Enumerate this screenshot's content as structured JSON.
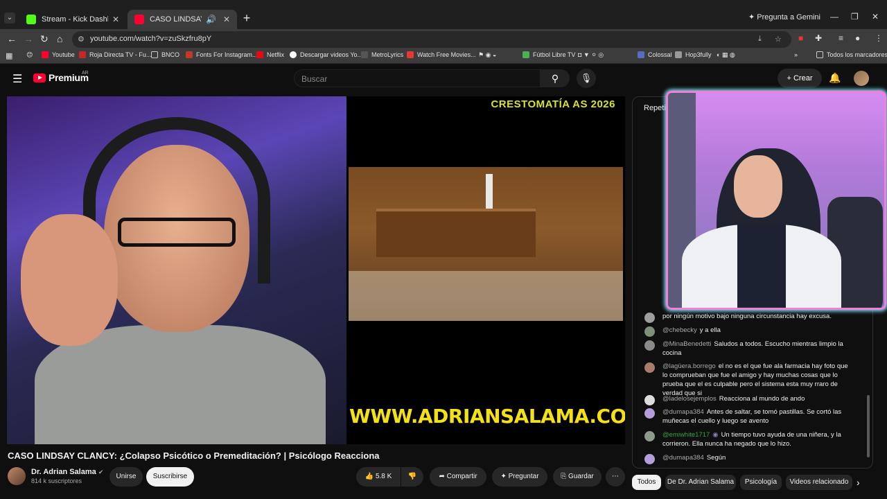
{
  "browser": {
    "tabs": [
      {
        "title": "Stream - Kick Dashboard",
        "favicon_color": "#53fc18"
      },
      {
        "title": "CASO LINDSAY CLANCY: ¿C",
        "favicon_color": "#ff0033"
      }
    ],
    "gemini_label": "Pregunta a Gemini",
    "url": "youtube.com/watch?v=zuSkzfru8pY",
    "bookmarks": [
      {
        "label": "Youtube",
        "color": "#ff0033"
      },
      {
        "label": "Roja Directa TV - Fu...",
        "color": "#c62828"
      },
      {
        "label": "BNCO",
        "color": "#888888"
      },
      {
        "label": "Fonts For Instagram...",
        "color": "#c0392b"
      },
      {
        "label": "Netflix",
        "color": "#e50914"
      },
      {
        "label": "Descargar videos Yo...",
        "color": "#ffffff"
      },
      {
        "label": "MetroLyrics",
        "color": "#333333"
      },
      {
        "label": "Watch Free Movies...",
        "color": "#e53935"
      },
      {
        "label": "Fútbol Libre TV",
        "color": "#4caf50"
      },
      {
        "label": "Colossal",
        "color": "#5c6bc0"
      },
      {
        "label": "Hop3fully",
        "color": "#999999"
      }
    ],
    "all_bookmarks": "Todos los marcadores"
  },
  "youtube": {
    "logo_word": "Premium",
    "region": "AR",
    "search_placeholder": "Buscar",
    "create_label": "Crear"
  },
  "video": {
    "slide_headline": "CRESTOMATÍA AS 2026",
    "slide_site": "WWW.ADRIANSALAMA.COM",
    "title": "CASO LINDSAY CLANCY: ¿Colapso Psicótico o Premeditación? | Psicólogo Reacciona",
    "channel": "Dr. Adrian Salama",
    "subscribers": "814 k suscriptores",
    "join_label": "Unirse",
    "subscribe_label": "Suscribirse",
    "likes": "5.8 K",
    "share_label": "Compartir",
    "ask_label": "Preguntar",
    "save_label": "Guardar"
  },
  "chat": {
    "header": "Repeti",
    "messages": [
      {
        "author": "",
        "text": "por ningún motivo bajo ninguna circunstancia hay excusa.",
        "author_color": "#aaaaaa",
        "avatar_color": "#9e9e9e"
      },
      {
        "author": "@chebecky",
        "text": "y a ella",
        "avatar_color": "#7e8f7a"
      },
      {
        "author": "@MinaBenedetti",
        "text": "Saludos a todos. Escucho mientras limpio la cocina",
        "avatar_color": "#8a8a8a"
      },
      {
        "author": "@lagüera.borrego",
        "text": "el no es el que fue ala farmacia hay foto que lo comprueban que fue el amigo y hay muchas cosas que lo prueba que el es culpable pero el sistema esta muy rraro de verdad que si",
        "avatar_color": "#a97b6a"
      },
      {
        "author": "@ladelosejemplos",
        "text": "Reacciona al mundo de ando",
        "avatar_color": "#dddddd"
      },
      {
        "author": "@dumapa384",
        "text": "Antes de saltar, se tomó pastillas. Se cortó las muñecas el cuello y luego se avento",
        "avatar_color": "#b39ddb"
      },
      {
        "author": "@emiwhite1717",
        "text": "Un tiempo tuvo ayuda de una niñera, y la corrieron. Ella nunca ha negado que lo hizo.",
        "avatar_color": "#8d9b8a",
        "member": true
      },
      {
        "author": "@dumapa384",
        "text": "Según",
        "avatar_color": "#b39ddb"
      }
    ]
  },
  "chips": [
    {
      "label": "Todos",
      "selected": true
    },
    {
      "label": "De Dr. Adrian Salama"
    },
    {
      "label": "Psicología"
    },
    {
      "label": "Videos relacionado"
    }
  ]
}
